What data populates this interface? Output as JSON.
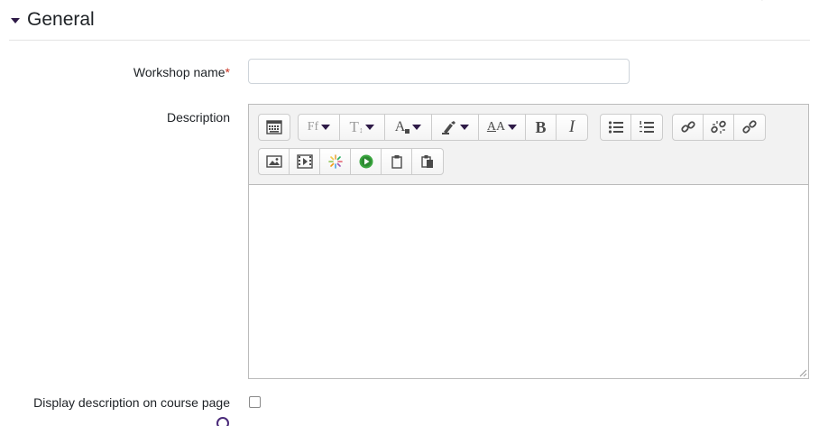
{
  "section": {
    "title": "General",
    "top_right_glyph": "'"
  },
  "form": {
    "workshop_name": {
      "label": "Workshop name",
      "required_mark": "*",
      "value": ""
    },
    "description": {
      "label": "Description",
      "toolbar_row1": [
        {
          "icon": "collapse-toolbar-icon"
        },
        {
          "icon": "font-family-icon",
          "text": "Ff",
          "dropdown": true
        },
        {
          "icon": "font-size-icon",
          "text": "T",
          "dropdown": true
        },
        {
          "icon": "font-color-icon",
          "text": "A",
          "dropdown": true
        },
        {
          "icon": "background-color-icon",
          "dropdown": true
        },
        {
          "icon": "text-style-icon",
          "text": "A",
          "dropdown": true
        },
        {
          "icon": "bold-icon",
          "text": "B"
        },
        {
          "icon": "italic-icon",
          "text": "I"
        },
        {
          "icon": "unordered-list-icon"
        },
        {
          "icon": "ordered-list-icon"
        },
        {
          "icon": "link-icon"
        },
        {
          "icon": "unlink-icon"
        },
        {
          "icon": "anchor-link-icon"
        }
      ],
      "toolbar_row2": [
        {
          "icon": "insert-image-icon"
        },
        {
          "icon": "insert-media-icon"
        },
        {
          "icon": "h5p-icon"
        },
        {
          "icon": "record-video-icon"
        },
        {
          "icon": "copy-icon"
        },
        {
          "icon": "paste-icon"
        }
      ]
    },
    "display_description": {
      "label": "Display description on course page",
      "checked": false
    }
  }
}
